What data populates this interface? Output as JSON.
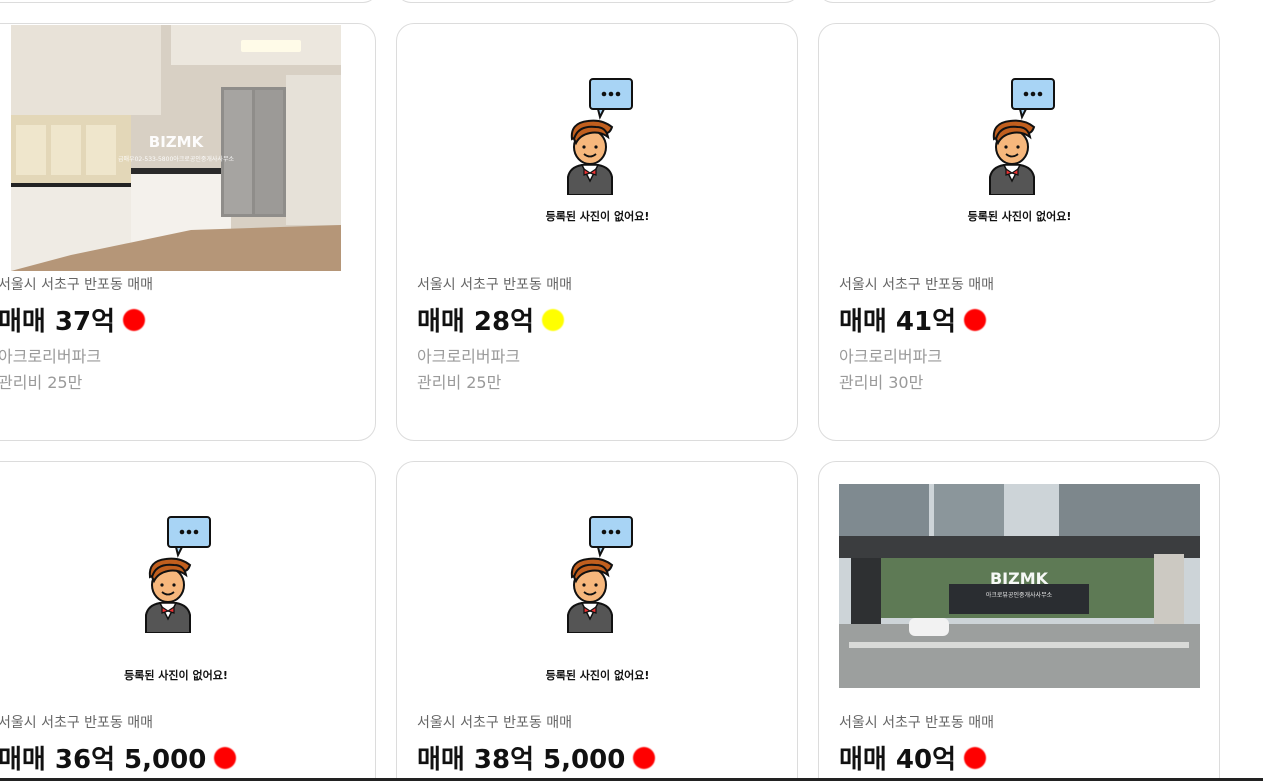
{
  "placeholder_text": "등록된 사진이 없어요!",
  "watermark": {
    "brand": "BIZMK",
    "kitchen_sub": "급매우02-533-5800아크로공인중개사사무소",
    "gate_sub": "아크로뷰공인중개사사무소"
  },
  "status_colors": {
    "red": "#ff0000",
    "yellow": "#ffff00"
  },
  "listings": [
    {
      "location": "서울시 서초구 반포동 매매",
      "price": "매매 37억",
      "status_color": "red",
      "complex": "아크로리버파크",
      "fee": "관리비 25만",
      "image": "kitchen-photo"
    },
    {
      "location": "서울시 서초구 반포동 매매",
      "price": "매매 28억",
      "status_color": "yellow",
      "complex": "아크로리버파크",
      "fee": "관리비 25만",
      "image": "placeholder"
    },
    {
      "location": "서울시 서초구 반포동 매매",
      "price": "매매 41억",
      "status_color": "red",
      "complex": "아크로리버파크",
      "fee": "관리비 30만",
      "image": "placeholder"
    },
    {
      "location": "서울시 서초구 반포동 매매",
      "price": "매매 36억 5,000",
      "status_color": "red",
      "image": "placeholder"
    },
    {
      "location": "서울시 서초구 반포동 매매",
      "price": "매매 38억 5,000",
      "status_color": "red",
      "image": "placeholder"
    },
    {
      "location": "서울시 서초구 반포동 매매",
      "price": "매매 40억",
      "status_color": "red",
      "image": "entrance-photo"
    }
  ]
}
